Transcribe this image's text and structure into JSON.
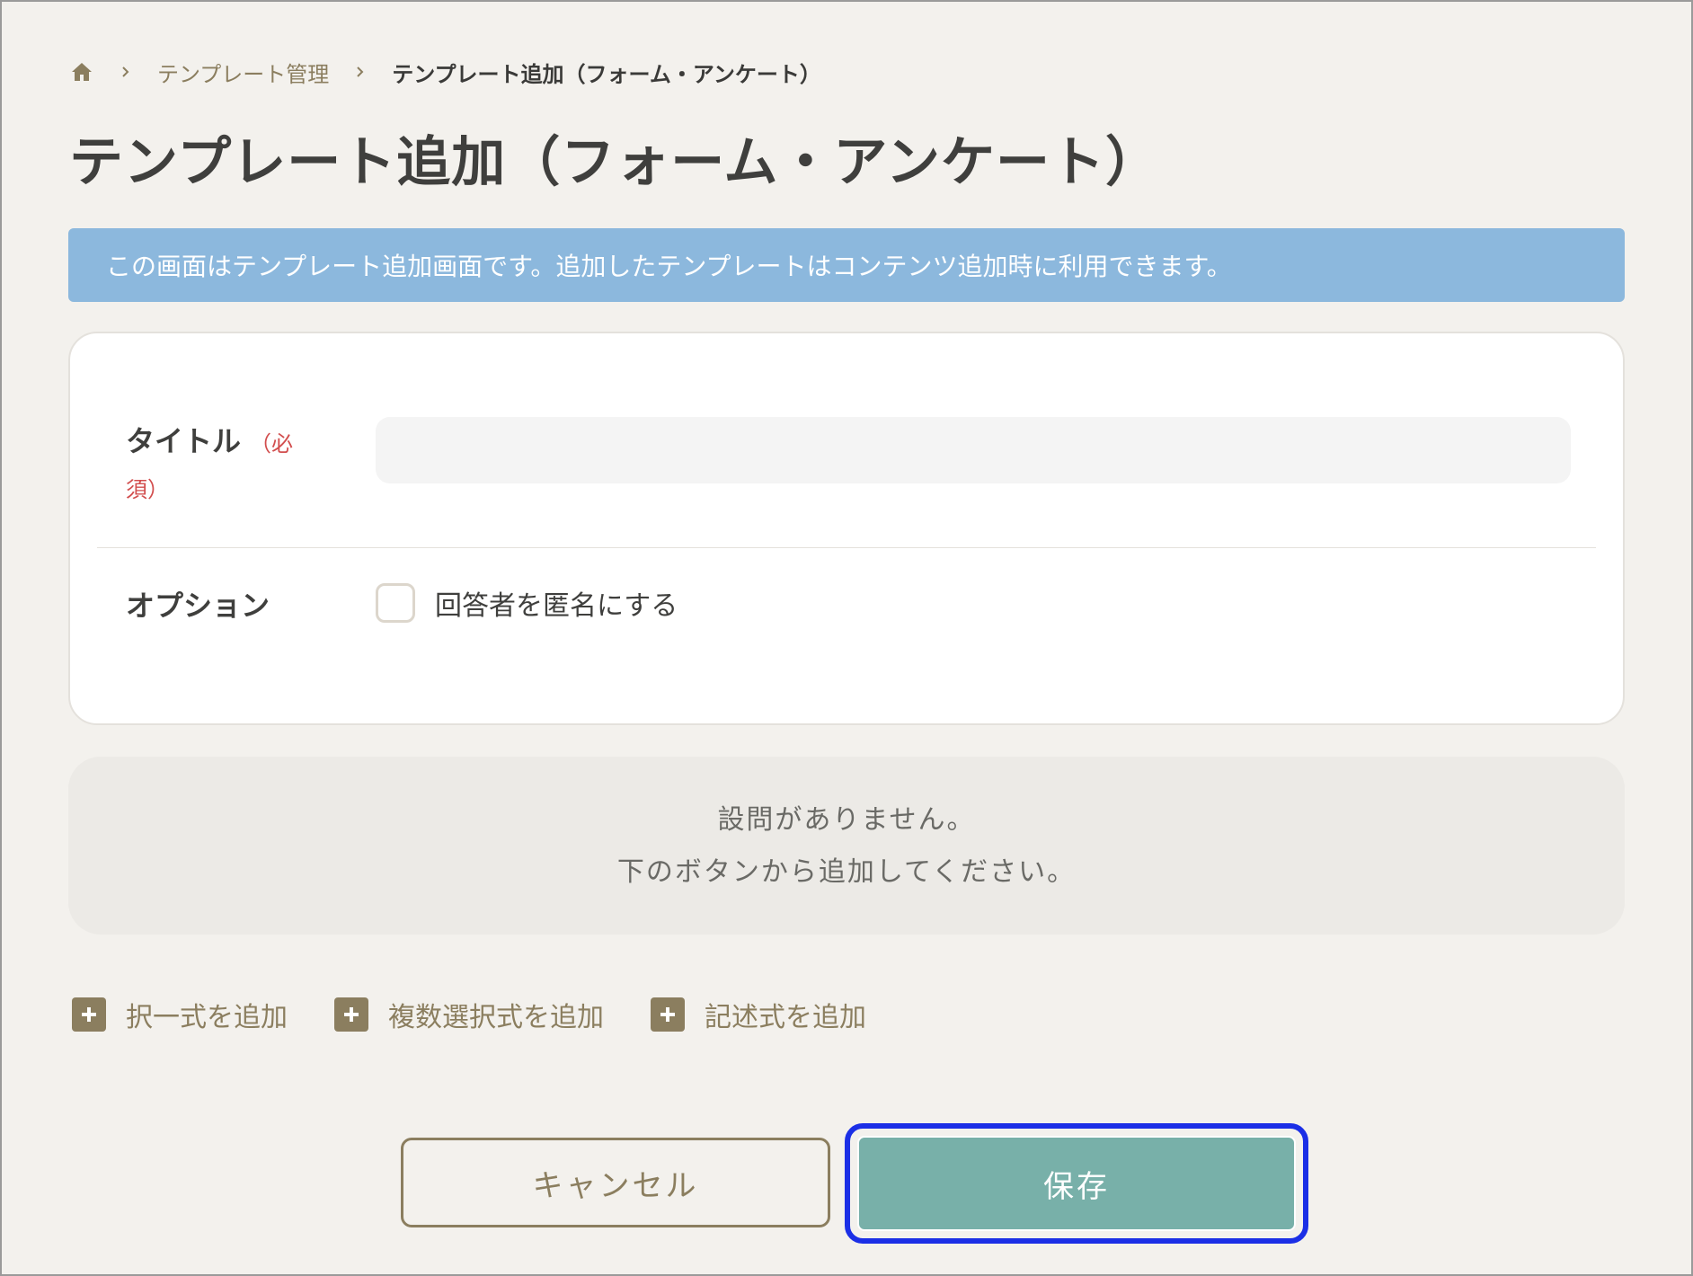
{
  "breadcrumb": {
    "home_icon": "home-icon",
    "items": [
      {
        "label": "テンプレート管理"
      },
      {
        "label": "テンプレート追加（フォーム・アンケート）"
      }
    ]
  },
  "page": {
    "title": "テンプレート追加（フォーム・アンケート）"
  },
  "info_banner": {
    "text": "この画面はテンプレート追加画面です。追加したテンプレートはコンテンツ追加時に利用できます。"
  },
  "form": {
    "title_field": {
      "label": "タイトル",
      "required_text": "（必須）",
      "value": "",
      "placeholder": ""
    },
    "options": {
      "label": "オプション",
      "anonymous_checkbox": {
        "label": "回答者を匿名にする",
        "checked": false
      }
    }
  },
  "empty_state": {
    "line1": "設問がありません。",
    "line2": "下のボタンから追加してください。"
  },
  "add_actions": [
    {
      "label": "択一式を追加",
      "icon": "plus-icon"
    },
    {
      "label": "複数選択式を追加",
      "icon": "plus-icon"
    },
    {
      "label": "記述式を追加",
      "icon": "plus-icon"
    }
  ],
  "footer": {
    "cancel_label": "キャンセル",
    "save_label": "保存"
  },
  "colors": {
    "background": "#f3f1ed",
    "accent_brown": "#8b7e5f",
    "banner_blue": "#8cb8dd",
    "save_teal": "#78b0a9",
    "required_red": "#d24e4e",
    "focus_ring": "#1b2fe6"
  }
}
